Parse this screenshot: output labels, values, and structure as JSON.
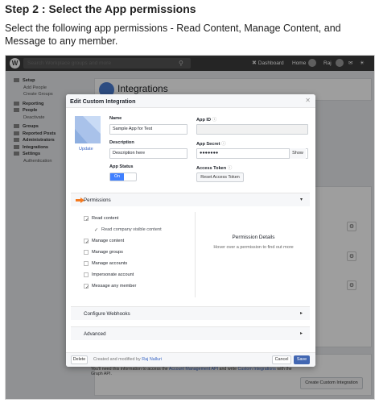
{
  "doc": {
    "title": "Step 2 : Select the App permissions",
    "text": "Select the following app permissions - Read Content, Manage Content, and Message to any member."
  },
  "topbar": {
    "logo": "W",
    "search_placeholder": "Search Workplace groups and more",
    "dashboard": "Dashboard",
    "home": "Home",
    "user": "Raj"
  },
  "sidebar": {
    "setup": "Setup",
    "add_people": "Add People",
    "create_groups": "Create Groups",
    "reporting": "Reporting",
    "people": "People",
    "deactivate": "Deactivate",
    "groups": "Groups",
    "reported_posts": "Reported Posts",
    "administrators": "Administrators",
    "integrations": "Integrations",
    "settings": "Settings",
    "authentication": "Authentication"
  },
  "background": {
    "page_title": "Integrations",
    "note_prefix": "You'll need this information to access the ",
    "note_link1": "Account Management API",
    "note_mid": " and write ",
    "note_link2": "Custom Integrations",
    "note_suffix": " with the Graph API.",
    "create_button": "Create Custom Integration"
  },
  "modal": {
    "title": "Edit Custom Integration",
    "update": "Update",
    "name_label": "Name",
    "name_value": "Sample App for Test",
    "description_label": "Description",
    "description_value": "Description here",
    "app_status_label": "App Status",
    "app_status_value": "On",
    "app_id_label": "App ID",
    "app_secret_label": "App Secret",
    "app_secret_value": "●●●●●●●",
    "show": "Show",
    "access_token_label": "Access Token",
    "reset_token": "Reset Access Token",
    "permissions_title": "Permissions",
    "permissions": [
      {
        "label": "Read content",
        "checked": true
      },
      {
        "label": "Read company visible content",
        "checked": true
      },
      {
        "label": "Manage content",
        "checked": true
      },
      {
        "label": "Manage groups",
        "checked": false
      },
      {
        "label": "Manage accounts",
        "checked": false
      },
      {
        "label": "Impersonate account",
        "checked": false
      },
      {
        "label": "Message any member",
        "checked": true
      }
    ],
    "permission_details_title": "Permission Details",
    "permission_details_hint": "Hover over a permission to find out more",
    "configure_webhooks": "Configure Webhooks",
    "advanced": "Advanced",
    "delete": "Delete",
    "created_by_prefix": "Created and modified by ",
    "created_by_name": "Raj Nalluri",
    "cancel": "Cancel",
    "save": "Save"
  },
  "colors": {
    "accent": "#4267b2",
    "toggle_on": "#4080ff",
    "arrow": "#f47a20",
    "topbar": "#3c3c3c"
  }
}
